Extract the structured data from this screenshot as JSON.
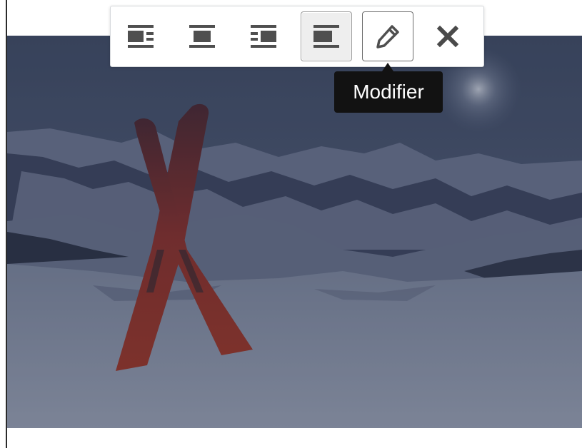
{
  "toolbar": {
    "buttons": [
      {
        "icon": "align-left-icon",
        "state": "normal"
      },
      {
        "icon": "align-center-icon",
        "state": "normal"
      },
      {
        "icon": "align-right-icon",
        "state": "normal"
      },
      {
        "icon": "align-none-icon",
        "state": "active"
      },
      {
        "icon": "pencil-icon",
        "state": "focused"
      },
      {
        "icon": "close-icon",
        "state": "normal"
      }
    ]
  },
  "tooltip": {
    "label": "Modifier"
  },
  "image": {
    "subject": "crossed-skis-in-snow-mountains"
  },
  "colors": {
    "icon": "#4f4f4f",
    "tooltip_bg": "#121212",
    "image_overlay": "#2a3246"
  }
}
